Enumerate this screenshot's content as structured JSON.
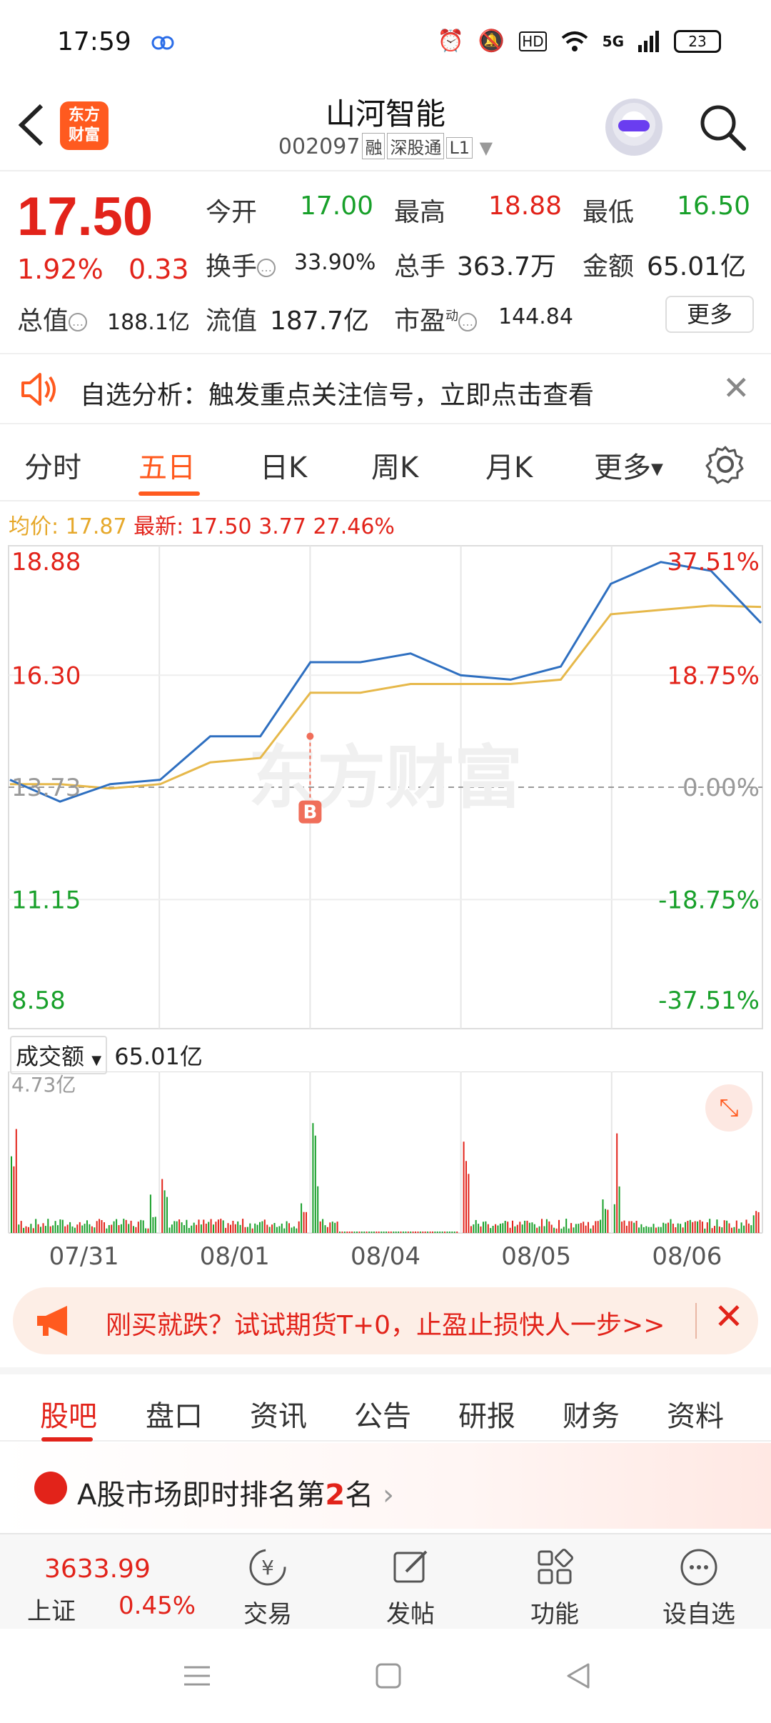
{
  "status": {
    "time": "17:59",
    "battery": "23",
    "network": "5G",
    "hd": "HD"
  },
  "header": {
    "logo_line1": "东方",
    "logo_line2": "财富",
    "name": "山河智能",
    "code": "002097",
    "tags": [
      "融",
      "深股通",
      "L1"
    ]
  },
  "quote": {
    "price": "17.50",
    "pct_change": "1.92%",
    "change": "0.33",
    "open_label": "今开",
    "open": "17.00",
    "high_label": "最高",
    "high": "18.88",
    "low_label": "最低",
    "low": "16.50",
    "turnover_label": "换手",
    "turnover": "33.90%",
    "volume_label": "总手",
    "volume": "363.7万",
    "amount_label": "金额",
    "amount": "65.01亿",
    "mcap_label": "总值",
    "mcap": "188.1亿",
    "float_label": "流值",
    "float": "187.7亿",
    "pe_label": "市盈",
    "pe_sup": "动",
    "pe": "144.84",
    "more": "更多"
  },
  "alert": {
    "text": "自选分析：触发重点关注信号，立即点击查看"
  },
  "tabs": [
    "分时",
    "五日",
    "日K",
    "周K",
    "月K",
    "更多"
  ],
  "legend": {
    "avg_label": "均价:",
    "avg": "17.87",
    "latest_label": "最新:",
    "latest": "17.50",
    "chg": "3.77",
    "pct": "27.46%"
  },
  "watermark": "东方财富",
  "chart_data": {
    "type": "line",
    "title": "五日",
    "x": [
      "07/31",
      "08/01",
      "08/04",
      "08/05",
      "08/06"
    ],
    "y_left_ticks": [
      "18.88",
      "16.30",
      "13.73",
      "11.15",
      "8.58"
    ],
    "y_right_ticks": [
      "37.51%",
      "18.75%",
      "0.00%",
      "-18.75%",
      "-37.51%"
    ],
    "ylim": [
      8.58,
      18.88
    ],
    "base": 13.73,
    "series": [
      {
        "name": "价格",
        "color": "#2e6fc0",
        "values": [
          13.9,
          13.4,
          13.8,
          13.9,
          14.9,
          14.9,
          16.6,
          16.6,
          16.8,
          16.3,
          16.2,
          16.5,
          18.4,
          18.9,
          18.7,
          17.5
        ]
      },
      {
        "name": "均价",
        "color": "#e6b84a",
        "values": [
          13.8,
          13.8,
          13.7,
          13.8,
          14.3,
          14.4,
          15.9,
          15.9,
          16.1,
          16.1,
          16.1,
          16.2,
          17.7,
          17.8,
          17.9,
          17.87
        ]
      }
    ],
    "marker": {
      "label": "B"
    },
    "volume": {
      "label": "成交额",
      "total": "65.01亿",
      "max_label": "4.73亿",
      "up_color": "#e2231a",
      "down_color": "#18a02a"
    }
  },
  "promo": {
    "text": "刚买就跌？试试期货T+0，止盈止损快人一步>>"
  },
  "bottom_tabs": [
    "股吧",
    "盘口",
    "资讯",
    "公告",
    "研报",
    "财务",
    "资料"
  ],
  "rank": {
    "prefix": "A股市场即时排名第",
    "rank": "2",
    "suffix": "名"
  },
  "bottombar": {
    "index_value": "3633.99",
    "index_name": "上证",
    "index_pct": "0.45%",
    "items": [
      "交易",
      "发帖",
      "功能",
      "设自选"
    ]
  }
}
